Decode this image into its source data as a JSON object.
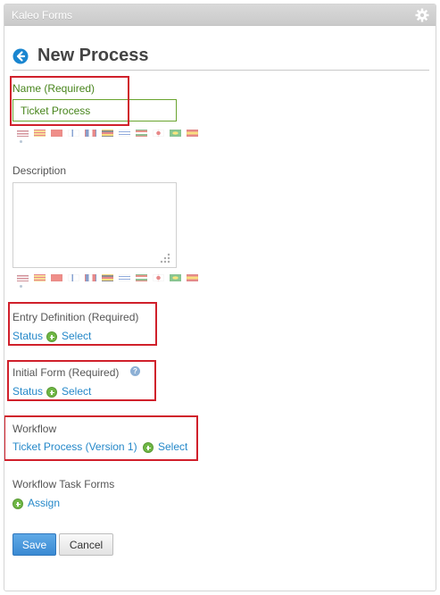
{
  "portlet": {
    "title": "Kaleo Forms"
  },
  "header": {
    "title": "New Process"
  },
  "name_field": {
    "label": "Name (Required)",
    "value": "Ticket Process"
  },
  "description": {
    "label": "Description",
    "value": ""
  },
  "entry_definition": {
    "label": "Entry Definition (Required)",
    "value_link": "Status",
    "select_label": "Select"
  },
  "initial_form": {
    "label": "Initial Form (Required)",
    "value_link": "Status",
    "select_label": "Select"
  },
  "workflow": {
    "label": "Workflow",
    "value_link": "Ticket Process (Version 1)",
    "select_label": "Select"
  },
  "workflow_task_forms": {
    "label": "Workflow Task Forms",
    "assign_label": "Assign"
  },
  "actions": {
    "save_label": "Save",
    "cancel_label": "Cancel"
  },
  "flags": [
    "en-US",
    "ca-ES",
    "zh-CN",
    "fi-FI",
    "fr-FR",
    "de-DE",
    "iw-IL",
    "hu-HU",
    "ja-JP",
    "pt-BR",
    "es-ES"
  ],
  "colors": {
    "required_green": "#48851c",
    "link_blue": "#2588c9",
    "highlight_red": "#d0202b",
    "primary_blue": "#3a8ad3"
  },
  "icons": {
    "config": "gear-icon",
    "back": "back-arrow-icon",
    "add": "plus-circle-icon",
    "help": "help-icon"
  }
}
